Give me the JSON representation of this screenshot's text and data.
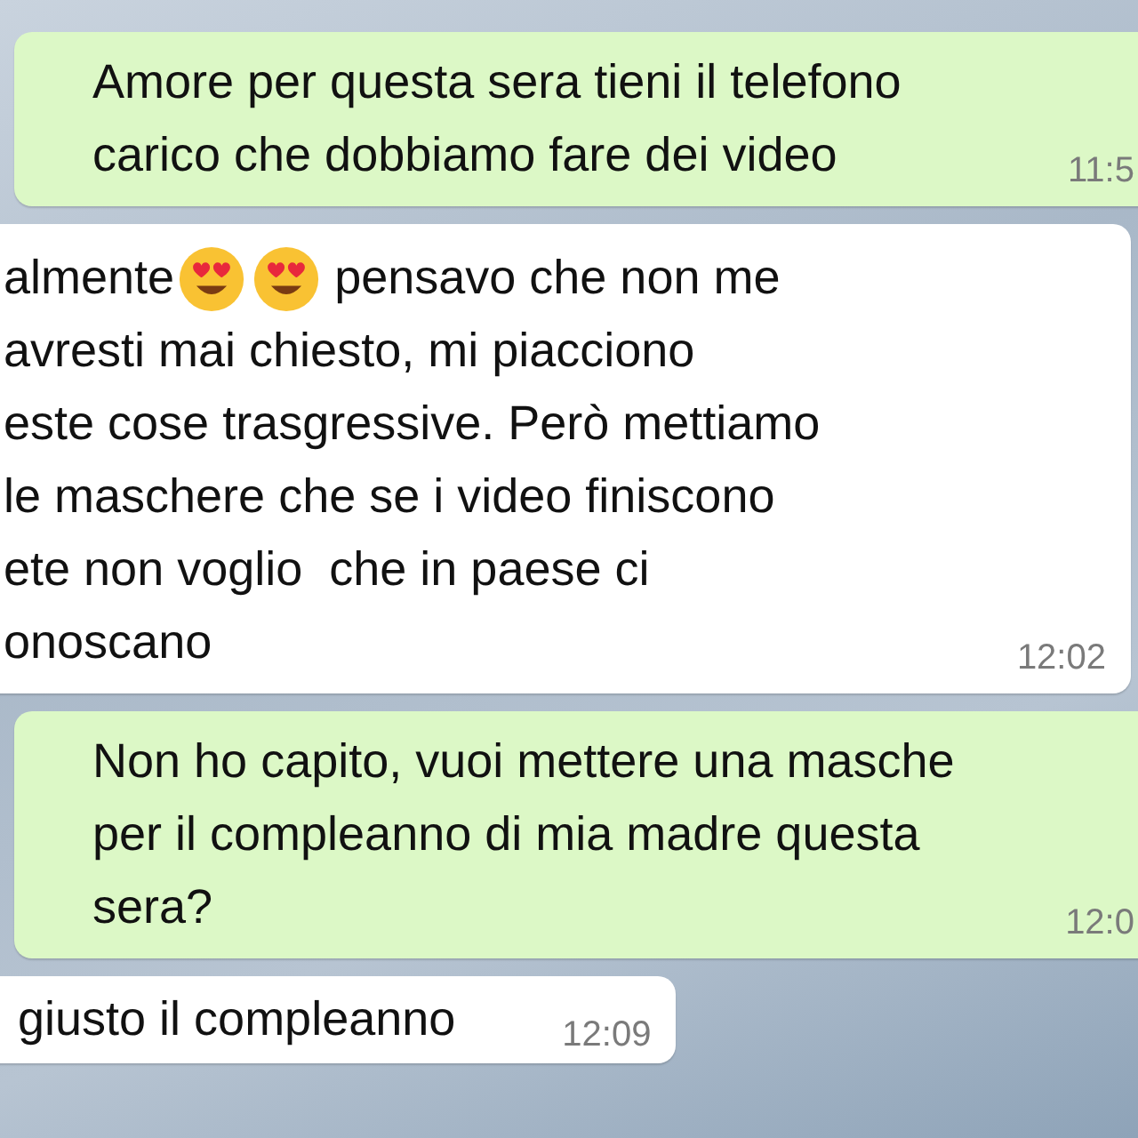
{
  "messages": [
    {
      "kind": "outgoing",
      "lines": [
        [
          {
            "kind": "text",
            "text": "Amore per questa sera tieni il telefono"
          }
        ],
        [
          {
            "kind": "text",
            "text": "carico che dobbiamo fare dei video"
          }
        ]
      ],
      "time": "11:5"
    },
    {
      "kind": "incoming",
      "lines": [
        [
          {
            "kind": "text",
            "text": "almente"
          },
          {
            "kind": "emoji"
          },
          {
            "kind": "emoji"
          },
          {
            "kind": "text",
            "text": "pensavo che non me"
          }
        ],
        [
          {
            "kind": "text",
            "text": "avresti mai chiesto, mi piacciono"
          }
        ],
        [
          {
            "kind": "text",
            "text": "este cose trasgressive. Però mettiamo"
          }
        ],
        [
          {
            "kind": "text",
            "text": "le maschere che se i video finiscono"
          }
        ],
        [
          {
            "kind": "text",
            "text": "ete non voglio  che in paese ci"
          }
        ],
        [
          {
            "kind": "text",
            "text": "onoscano"
          }
        ]
      ],
      "time": "12:02"
    },
    {
      "kind": "outgoing",
      "lines": [
        [
          {
            "kind": "text",
            "text": "Non ho capito, vuoi mettere una masche"
          }
        ],
        [
          {
            "kind": "text",
            "text": "per il compleanno di mia madre questa"
          }
        ],
        [
          {
            "kind": "text",
            "text": "sera?"
          }
        ]
      ],
      "time": "12:0"
    },
    {
      "kind": "incoming",
      "lines": [
        [
          {
            "kind": "text",
            "text": "giusto il compleanno"
          }
        ]
      ],
      "time": "12:09"
    }
  ]
}
